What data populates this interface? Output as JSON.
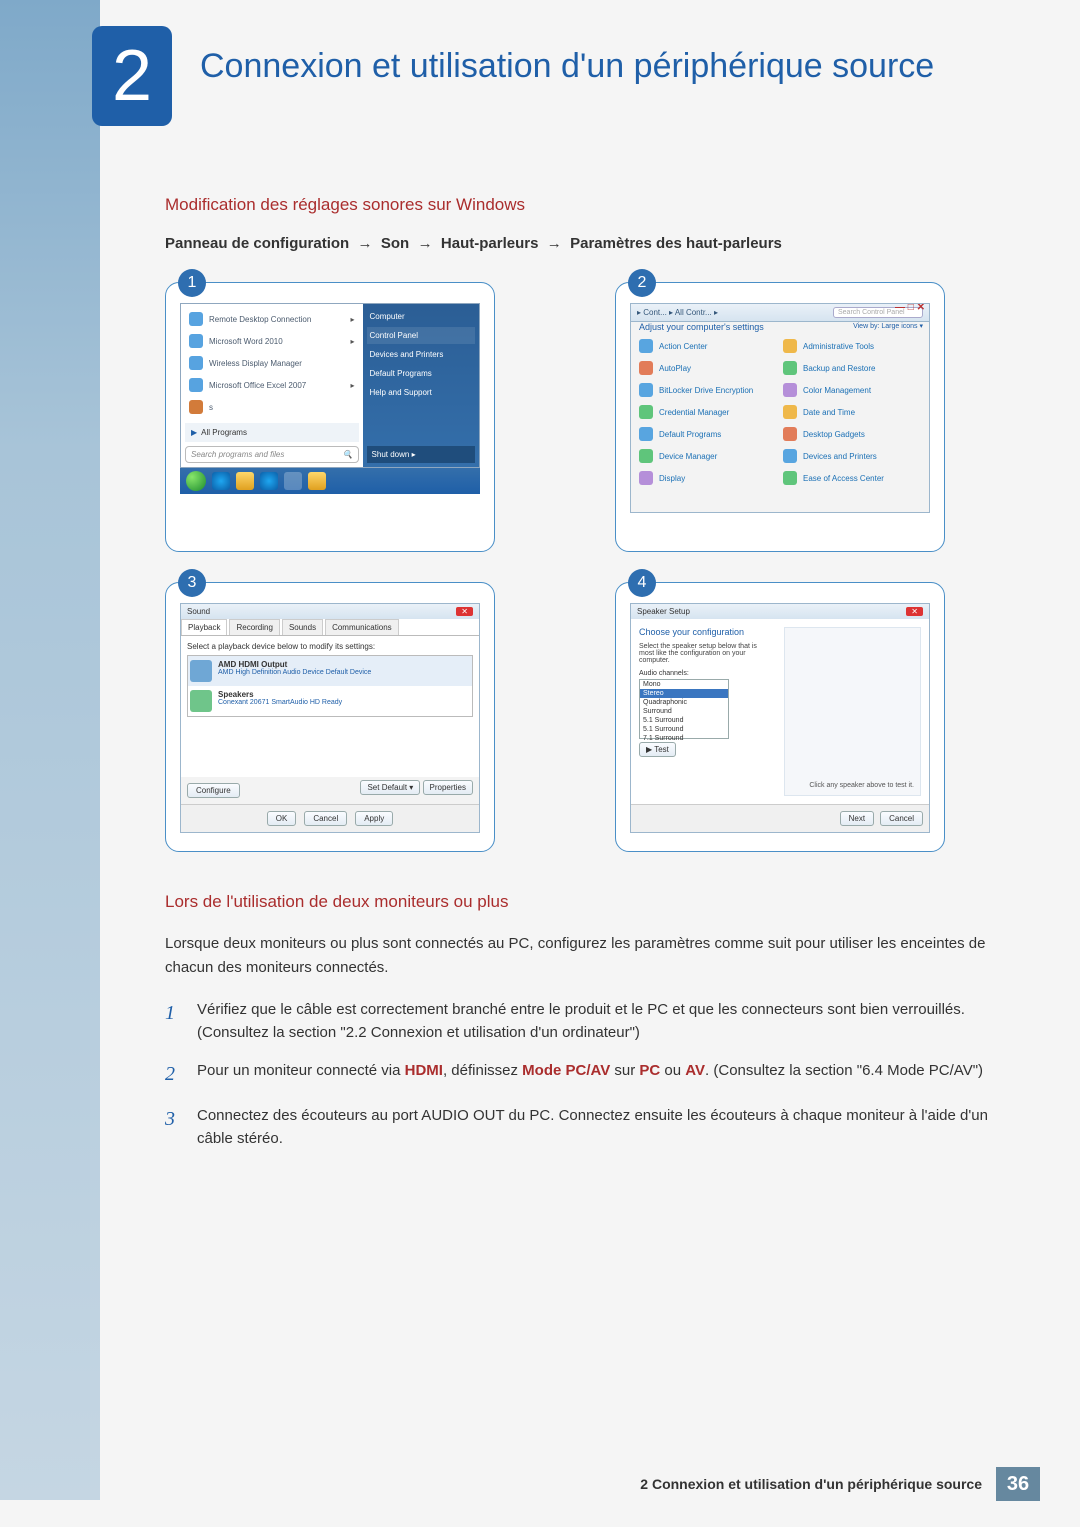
{
  "chapter": {
    "number": "2",
    "title": "Connexion et utilisation d'un périphérique source"
  },
  "section_mod_sound": {
    "heading": "Modification des réglages sonores sur Windows",
    "path_prefix": "Panneau de configuration",
    "arrow": "→",
    "p2": "Son",
    "p3": "Haut-parleurs",
    "p4": "Paramètres des haut-parleurs"
  },
  "screens": {
    "s1": {
      "step": "1",
      "start_left": [
        "Remote Desktop Connection",
        "Microsoft Word 2010",
        "Wireless Display Manager",
        "Microsoft Office Excel 2007"
      ],
      "all_programs": "All Programs",
      "search_placeholder": "Search programs and files",
      "start_right": [
        "Computer",
        "Control Panel",
        "Devices and Printers",
        "Default Programs",
        "Help and Support"
      ],
      "shutdown": "Shut down"
    },
    "s2": {
      "step": "2",
      "breadcrumb": "▸ Cont... ▸ All Contr... ▸",
      "search_placeholder": "Search Control Panel",
      "heading": "Adjust your computer's settings",
      "view_by": "View by:  Large icons ▾",
      "items_left": [
        "Action Center",
        "AutoPlay",
        "BitLocker Drive Encryption",
        "Credential Manager",
        "Default Programs",
        "Device Manager",
        "Display"
      ],
      "items_right": [
        "Administrative Tools",
        "Backup and Restore",
        "Color Management",
        "Date and Time",
        "Desktop Gadgets",
        "Devices and Printers",
        "Ease of Access Center"
      ]
    },
    "s3": {
      "step": "3",
      "title": "Sound",
      "tabs": [
        "Playback",
        "Recording",
        "Sounds",
        "Communications"
      ],
      "instruction": "Select a playback device below to modify its settings:",
      "dev1_name": "AMD HDMI Output",
      "dev1_sub": "AMD High Definition Audio Device\nDefault Device",
      "dev2_name": "Speakers",
      "dev2_sub": "Conexant 20671 SmartAudio HD\nReady",
      "btn_configure": "Configure",
      "btn_setdefault": "Set Default  ▾",
      "btn_properties": "Properties",
      "btn_ok": "OK",
      "btn_cancel": "Cancel",
      "btn_apply": "Apply"
    },
    "s4": {
      "step": "4",
      "breadcrumb": "Speaker Setup",
      "heading": "Choose your configuration",
      "desc": "Select the speaker setup below that is most like the configuration on your computer.",
      "list_label": "Audio channels:",
      "options": [
        "Mono",
        "Stereo",
        "Quadraphonic",
        "Surround",
        "5.1 Surround",
        "5.1 Surround",
        "7.1 Surround"
      ],
      "btn_test": "▶ Test",
      "hint": "Click any speaker above to test it.",
      "btn_next": "Next",
      "btn_cancel": "Cancel"
    }
  },
  "section_two_monitors": {
    "heading": "Lors de l'utilisation de deux moniteurs ou plus",
    "intro": "Lorsque deux moniteurs ou plus sont connectés au PC, configurez les paramètres comme suit pour utiliser les enceintes de chacun des moniteurs connectés.",
    "step1": "Vérifiez que le câble est correctement branché entre le produit et le PC et que les connecteurs sont bien verrouillés. (Consultez la section \"2.2 Connexion et utilisation d'un ordinateur\")",
    "step2_a": "Pour un moniteur connecté via ",
    "step2_hdmi": "HDMI",
    "step2_b": ", définissez ",
    "step2_mode": "Mode PC/AV",
    "step2_c": " sur ",
    "step2_pc": "PC",
    "step2_d": " ou ",
    "step2_av": "AV",
    "step2_e": ". (Consultez la section \"6.4 Mode PC/AV\")",
    "step3": "Connectez des écouteurs au port AUDIO OUT du PC. Connectez ensuite les écouteurs à chaque moniteur à l'aide d'un câble stéréo."
  },
  "footer": {
    "text": "2 Connexion et utilisation d'un périphérique source",
    "page": "36"
  }
}
